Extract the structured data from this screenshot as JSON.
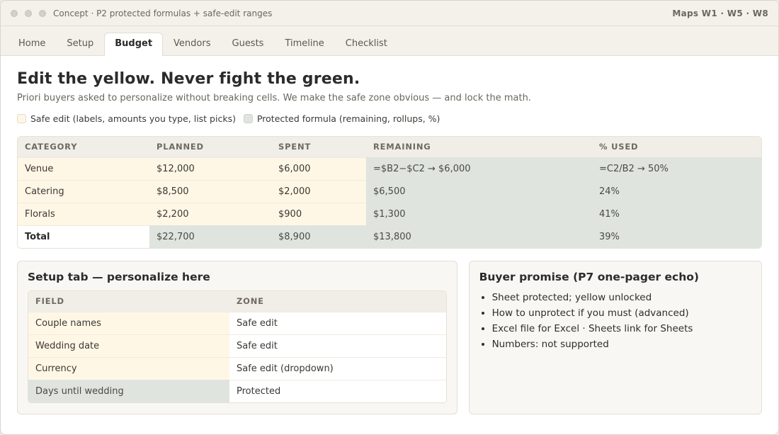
{
  "window": {
    "title": "Concept · P2 protected formulas + safe-edit ranges",
    "right_label": "Maps W1 · W5 · W8"
  },
  "tabs": [
    {
      "label": "Home",
      "active": false
    },
    {
      "label": "Setup",
      "active": false
    },
    {
      "label": "Budget",
      "active": true
    },
    {
      "label": "Vendors",
      "active": false
    },
    {
      "label": "Guests",
      "active": false
    },
    {
      "label": "Timeline",
      "active": false
    },
    {
      "label": "Checklist",
      "active": false
    }
  ],
  "header": {
    "title": "Edit the yellow. Never fight the green.",
    "subtitle": "Priori buyers asked to personalize without breaking cells. We make the safe zone obvious — and lock the math."
  },
  "legend": {
    "safe_label": "Safe edit (labels, amounts you type, list picks)",
    "protected_label": "Protected formula (remaining, rollups, %)"
  },
  "colors": {
    "safe": "#fff7e6",
    "protected": "#dfe4df",
    "header_bg": "#f1eee7"
  },
  "budget": {
    "columns": [
      "Category",
      "Planned",
      "Spent",
      "Remaining",
      "% Used"
    ],
    "rows": [
      [
        "Venue",
        "$12,000",
        "$6,000",
        "=$B2−$C2 → $6,000",
        "=C2/B2 → 50%"
      ],
      [
        "Catering",
        "$8,500",
        "$2,000",
        "$6,500",
        "24%"
      ],
      [
        "Florals",
        "$2,200",
        "$900",
        "$1,300",
        "41%"
      ]
    ],
    "total": [
      "Total",
      "$22,700",
      "$8,900",
      "$13,800",
      "39%"
    ]
  },
  "setup_card": {
    "title": "Setup tab — personalize here",
    "columns": [
      "Field",
      "Zone"
    ],
    "rows": [
      {
        "field": "Couple names",
        "zone": "Safe edit",
        "protected": false
      },
      {
        "field": "Wedding date",
        "zone": "Safe edit",
        "protected": false
      },
      {
        "field": "Currency",
        "zone": "Safe edit (dropdown)",
        "protected": false
      },
      {
        "field": "Days until wedding",
        "zone": "Protected",
        "protected": true
      }
    ]
  },
  "promise_card": {
    "title": "Buyer promise (P7 one-pager echo)",
    "items": [
      "Sheet protected; yellow unlocked",
      "How to unprotect if you must (advanced)",
      "Excel file for Excel · Sheets link for Sheets",
      "Numbers: not supported"
    ]
  }
}
